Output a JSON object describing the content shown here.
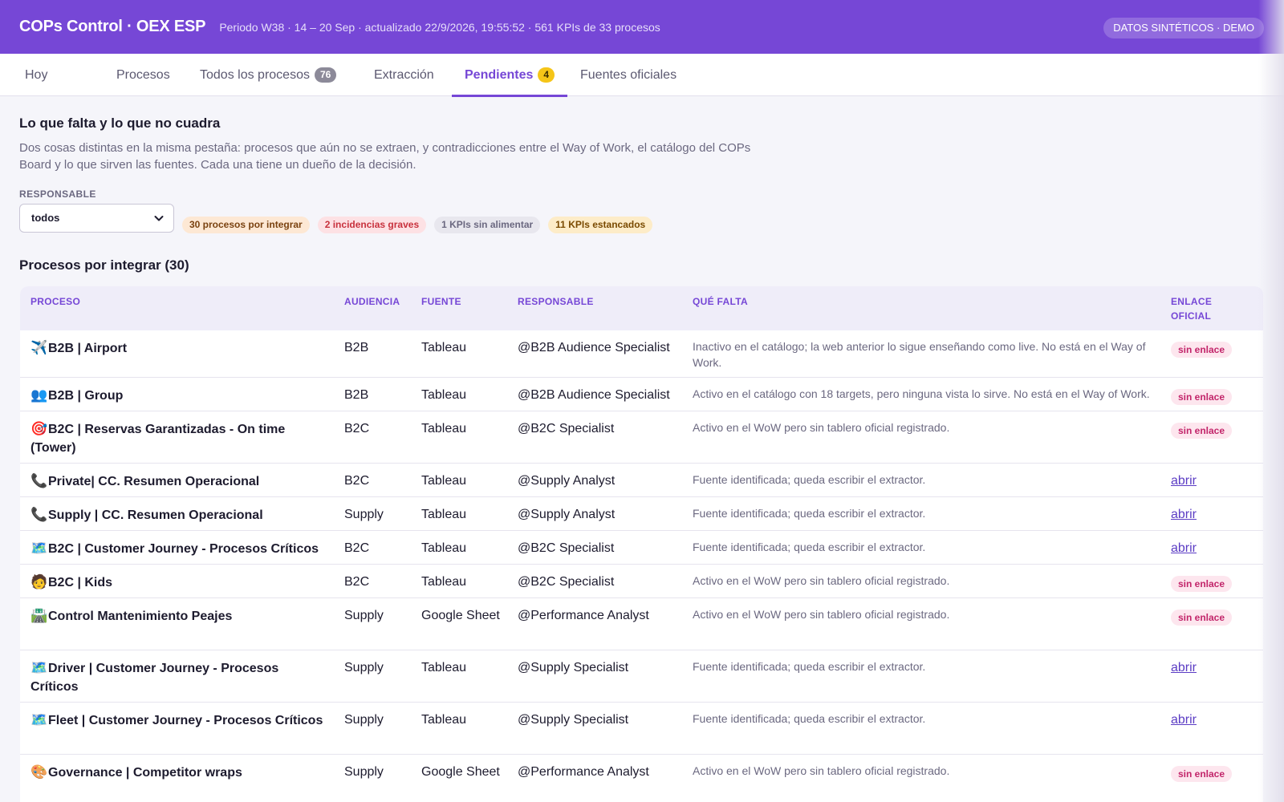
{
  "header": {
    "title": "COPs Control · OEX ESP",
    "meta": "Periodo W38 · 14 – 20 Sep · actualizado 22/9/2026, 19:55:52 · 561 KPIs de 33 procesos",
    "badge": "DATOS SINTÉTICOS · DEMO",
    "colors": {
      "accent": "#7647d6"
    }
  },
  "tabs": [
    {
      "label": "Hoy"
    },
    {
      "label": "Procesos"
    },
    {
      "label": "Todos los procesos",
      "count": "76"
    },
    {
      "label": "Extracción"
    },
    {
      "label": "Pendientes",
      "count": "4",
      "active": true
    },
    {
      "label": "Fuentes oficiales"
    }
  ],
  "intro": {
    "title": "Lo que falta y lo que no cuadra",
    "description": "Dos cosas distintas en la misma pestaña: procesos que aún no se extraen, y contradicciones entre el Way of Work, el catálogo del COPs Board y lo que sirven las fuentes. Cada una tiene un dueño de la decisión."
  },
  "filter": {
    "label": "RESPONSABLE",
    "selected": "todos",
    "icon": "chevron-down-icon"
  },
  "chips": [
    {
      "label": "30 procesos por integrar"
    },
    {
      "label": "2 incidencias graves"
    },
    {
      "label": "1 KPIs sin alimentar"
    },
    {
      "label": "11 KPIs estancados"
    }
  ],
  "table": {
    "title": "Procesos por integrar (30)",
    "headers": {
      "proceso": "PROCESO",
      "audiencia": "AUDIENCIA",
      "fuente": "FUENTE",
      "responsable": "RESPONSABLE",
      "falta": "QUÉ FALTA",
      "enlace_1": "ENLACE",
      "enlace_2": "OFICIAL"
    },
    "no_link_label": "sin enlace",
    "link_label": "abrir",
    "rows": [
      {
        "emoji": "✈️",
        "name": "B2B | Airport",
        "audience": "B2B",
        "source": "Tableau",
        "owner": "@B2B Audience Specialist",
        "missing": "Inactivo en el catálogo; la web anterior lo sigue enseñando como live. No está en el Way of Work.",
        "link": "sin enlace"
      },
      {
        "emoji": "👥",
        "name": "B2B | Group",
        "audience": "B2B",
        "source": "Tableau",
        "owner": "@B2B Audience Specialist",
        "missing": "Activo en el catálogo con 18 targets, pero ninguna vista lo sirve. No está en el Way of Work.",
        "link": "sin enlace"
      },
      {
        "emoji": "🎯",
        "name": "B2C | Reservas Garantizadas - On time (Tower)",
        "audience": "B2C",
        "source": "Tableau",
        "owner": "@B2C Specialist",
        "missing": "Activo en el WoW pero sin tablero oficial registrado.",
        "link": "sin enlace"
      },
      {
        "emoji": "📞",
        "name": "Private| CC. Resumen Operacional",
        "audience": "B2C",
        "source": "Tableau",
        "owner": "@Supply Analyst",
        "missing": "Fuente identificada; queda escribir el extractor.",
        "link": "abrir"
      },
      {
        "emoji": "📞",
        "name": "Supply | CC. Resumen Operacional",
        "audience": "Supply",
        "source": "Tableau",
        "owner": "@Supply Analyst",
        "missing": "Fuente identificada; queda escribir el extractor.",
        "link": "abrir"
      },
      {
        "emoji": "🗺️",
        "name": "B2C | Customer Journey - Procesos Críticos",
        "audience": "B2C",
        "source": "Tableau",
        "owner": "@B2C Specialist",
        "missing": "Fuente identificada; queda escribir el extractor.",
        "link": "abrir"
      },
      {
        "emoji": "🧑",
        "name": "B2C | Kids",
        "audience": "B2C",
        "source": "Tableau",
        "owner": "@B2C Specialist",
        "missing": "Activo en el WoW pero sin tablero oficial registrado.",
        "link": "sin enlace"
      },
      {
        "emoji": "🛣️",
        "name": "Control Mantenimiento Peajes",
        "audience": "Supply",
        "source": "Google Sheet",
        "owner": "@Performance Analyst",
        "missing": "Activo en el WoW pero sin tablero oficial registrado.",
        "link": "sin enlace"
      },
      {
        "emoji": "🗺️",
        "name": "Driver | Customer Journey - Procesos Críticos",
        "audience": "Supply",
        "source": "Tableau",
        "owner": "@Supply Specialist",
        "missing": "Fuente identificada; queda escribir el extractor.",
        "link": "abrir"
      },
      {
        "emoji": "🗺️",
        "name": "Fleet | Customer Journey - Procesos Críticos",
        "audience": "Supply",
        "source": "Tableau",
        "owner": "@Supply Specialist",
        "missing": "Fuente identificada; queda escribir el extractor.",
        "link": "abrir"
      },
      {
        "emoji": "🎨",
        "name": "Governance | Competitor wraps",
        "audience": "Supply",
        "source": "Google Sheet",
        "owner": "@Performance Analyst",
        "missing": "Activo en el WoW pero sin tablero oficial registrado.",
        "link": "sin enlace"
      }
    ]
  }
}
